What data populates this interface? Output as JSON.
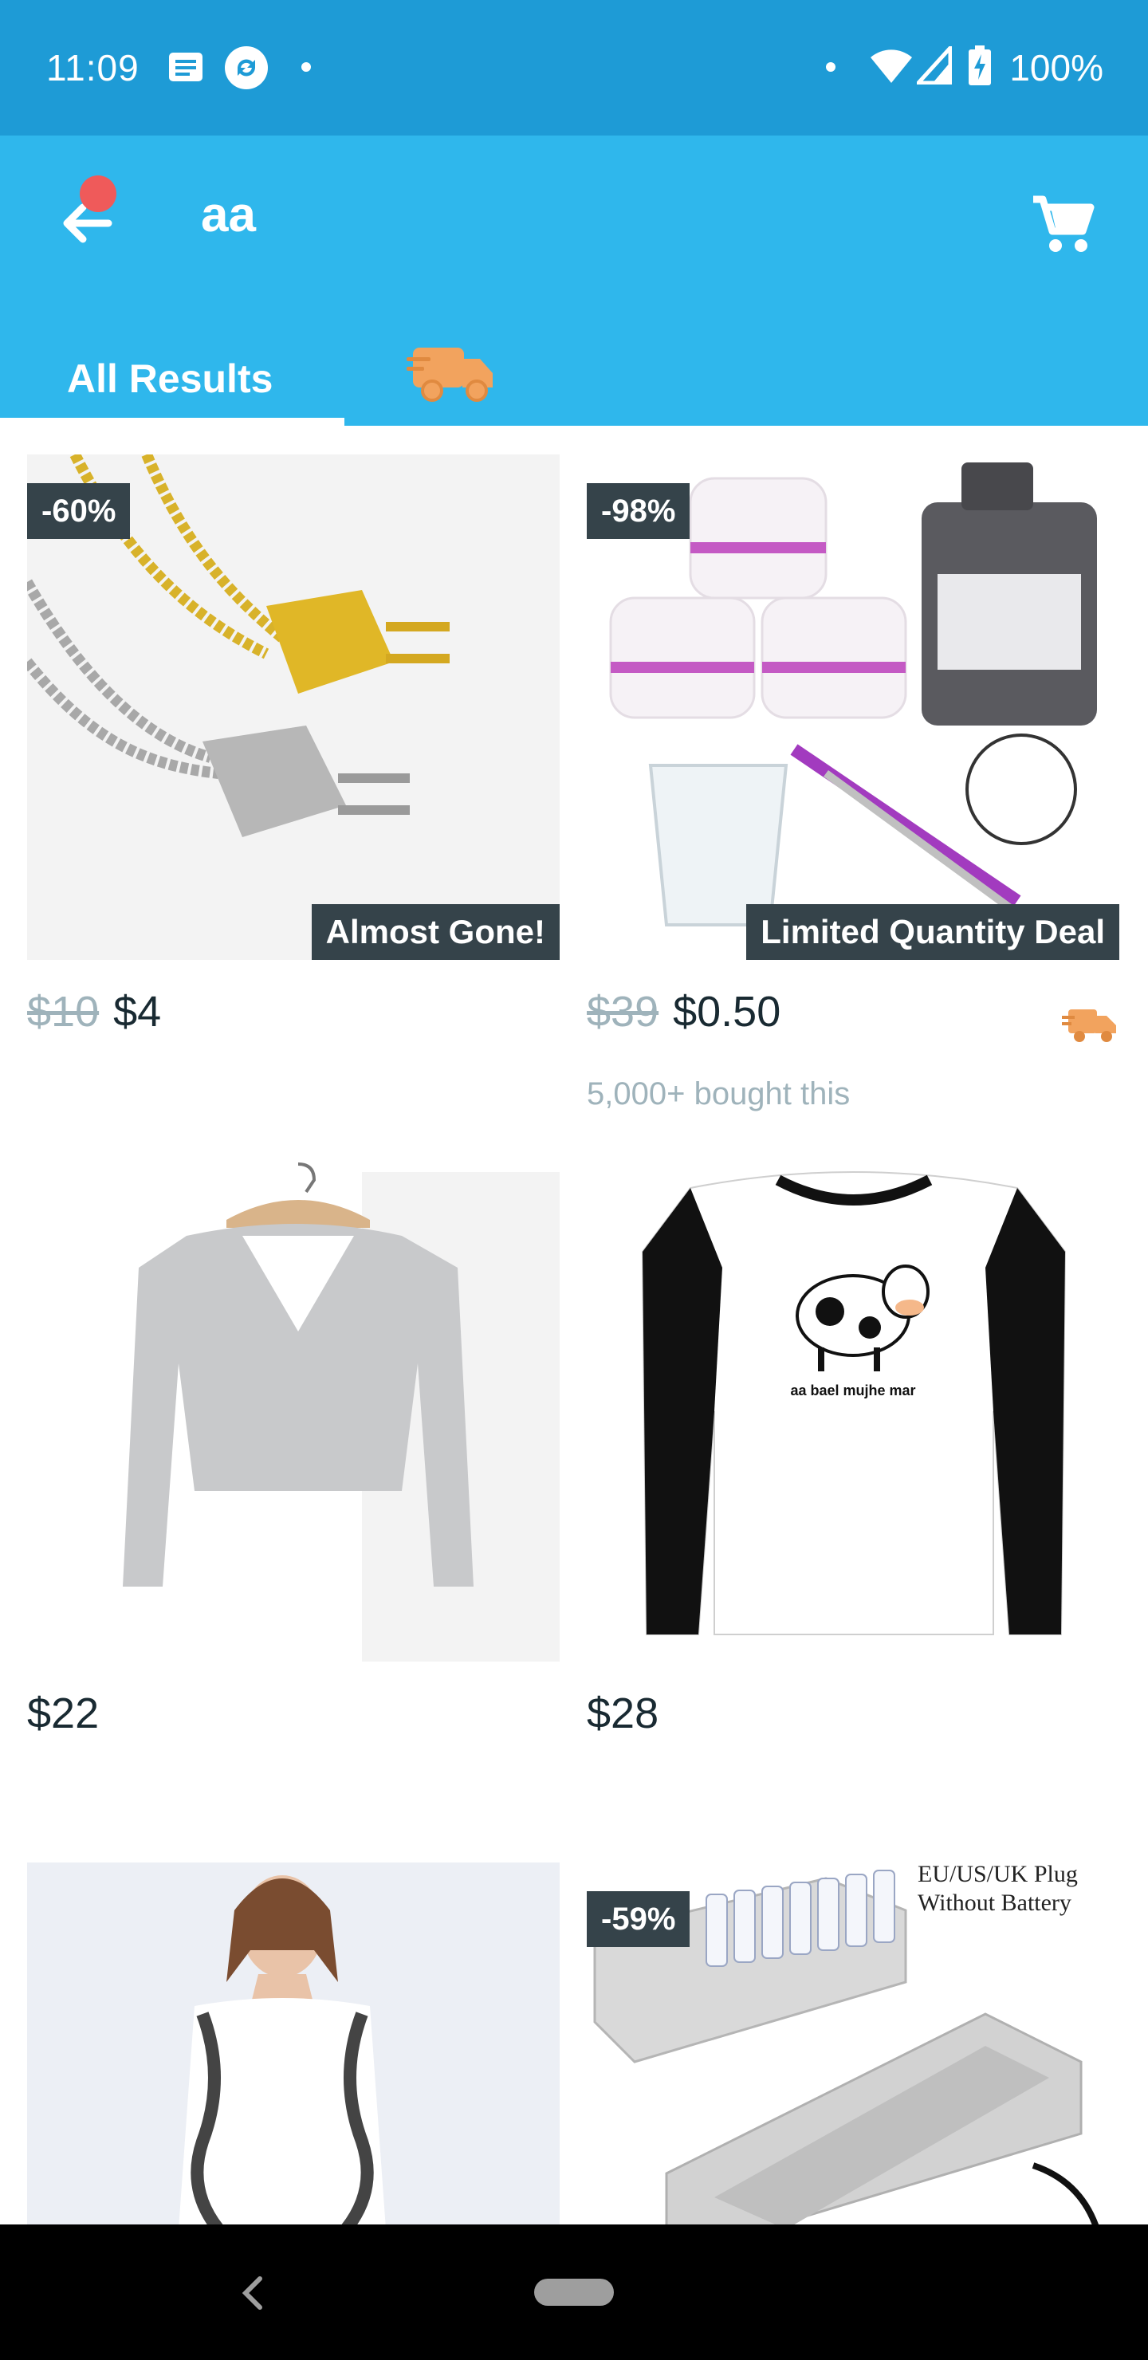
{
  "status_bar": {
    "time": "11:09",
    "battery": "100%",
    "icons": [
      "message-icon",
      "sync-icon",
      "dot-icon",
      "wifi-icon",
      "signal-icon",
      "battery-charging-icon"
    ]
  },
  "header": {
    "back_icon": "arrow-left-icon",
    "search_query": "aa",
    "cart_icon": "cart-icon"
  },
  "tabs": [
    {
      "label": "All Results",
      "selected": true
    },
    {
      "label": "",
      "icon": "shipping-truck-icon",
      "selected": false
    }
  ],
  "products": [
    {
      "discount": "-60%",
      "badge": "Almost Gone!",
      "original_price": "$10",
      "price": "$4",
      "bought": "",
      "fast_shipping": false
    },
    {
      "discount": "-98%",
      "badge": "Limited Quantity Deal",
      "original_price": "$39",
      "price": "$0.50",
      "bought": "5,000+ bought this",
      "fast_shipping": true
    },
    {
      "discount": "",
      "badge": "",
      "original_price": "",
      "price": "$22",
      "bought": "",
      "fast_shipping": false
    },
    {
      "discount": "",
      "badge": "",
      "original_price": "",
      "price": "$28",
      "bought": "",
      "fast_shipping": false,
      "image_text": "aa bael mujhe mar"
    },
    {
      "discount": "",
      "badge": "",
      "original_price": "",
      "price": "",
      "bought": "",
      "fast_shipping": false
    },
    {
      "discount": "-59%",
      "badge": "",
      "original_price": "",
      "price": "",
      "bought": "",
      "fast_shipping": false,
      "image_text": [
        "EU/US/UK Plug",
        "Without Battery"
      ]
    }
  ],
  "colors": {
    "status_bar": "#1e9bd6",
    "app_bar": "#2fb7ec",
    "badge_bg": "#35434a",
    "strike_price": "#9fb3bb",
    "shipping_orange": "#f2a35e",
    "notification_dot": "#ef5a5a"
  }
}
